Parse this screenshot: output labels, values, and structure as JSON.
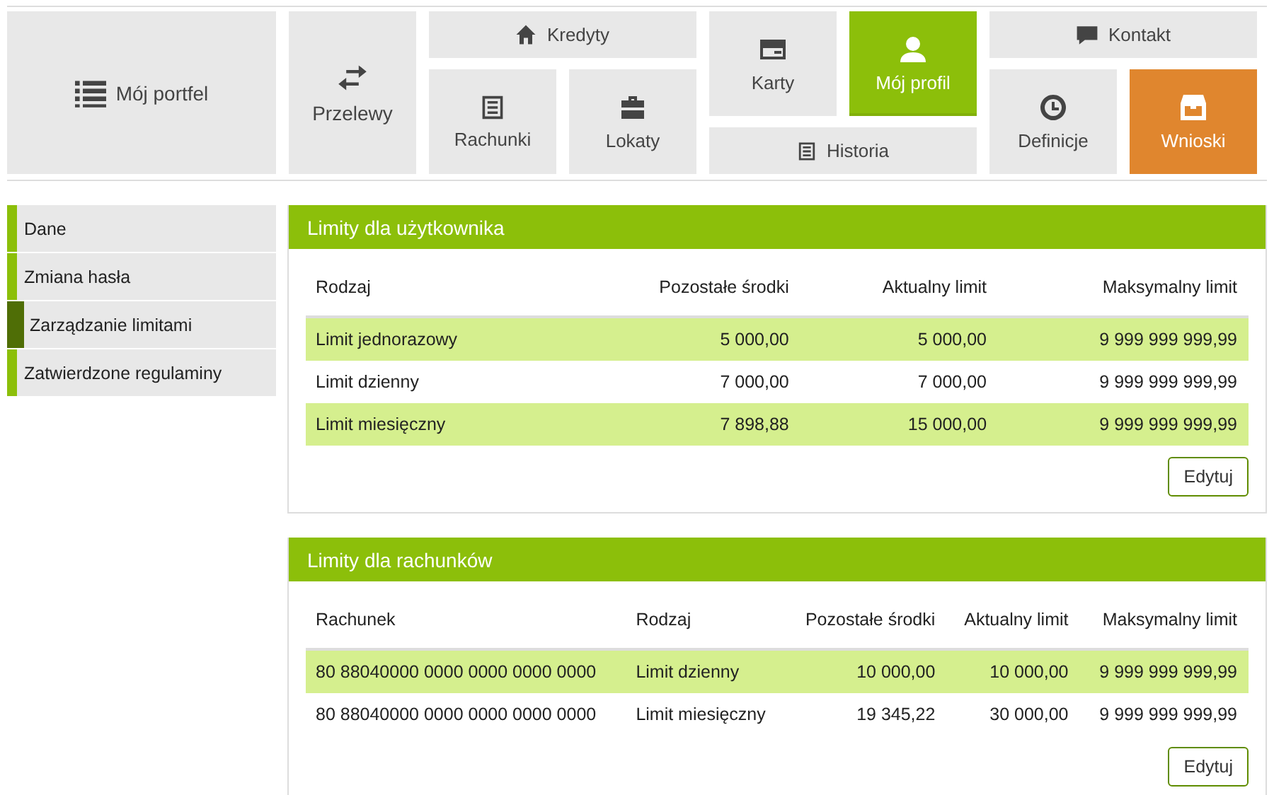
{
  "tiles": [
    {
      "label": "Mój portfel",
      "selected": false,
      "color": "#e8e8e8"
    },
    {
      "label": "Przelewy",
      "selected": false,
      "color": "#e8e8e8"
    },
    {
      "label": "Kredyty",
      "selected": false,
      "color": "#e8e8e8"
    },
    {
      "label": "Rachunki",
      "selected": false,
      "color": "#e8e8e8"
    },
    {
      "label": "Lokaty",
      "selected": false,
      "color": "#e8e8e8"
    },
    {
      "label": "Karty",
      "selected": false,
      "color": "#e8e8e8"
    },
    {
      "label": "Mój profil",
      "selected": true,
      "color": "#8cbf0a"
    },
    {
      "label": "Historia",
      "selected": false,
      "color": "#e8e8e8"
    },
    {
      "label": "Kontakt",
      "selected": false,
      "color": "#e8e8e8"
    },
    {
      "label": "Definicje",
      "selected": false,
      "color": "#e8e8e8"
    },
    {
      "label": "Wnioski",
      "selected": false,
      "color": "#e0862e"
    }
  ],
  "sidebar": {
    "items": [
      {
        "label": "Dane",
        "selected": false
      },
      {
        "label": "Zmiana hasła",
        "selected": false
      },
      {
        "label": "Zarządzanie limitami",
        "selected": true
      },
      {
        "label": "Zatwierdzone regulaminy",
        "selected": false
      }
    ]
  },
  "panels": [
    {
      "title": "Limity dla użytkownika",
      "columns": [
        "Rodzaj",
        "Pozostałe środki",
        "Aktualny limit",
        "Maksymalny limit"
      ],
      "rows": [
        [
          "Limit jednorazowy",
          "5 000,00",
          "5 000,00",
          "9 999 999 999,99"
        ],
        [
          "Limit dzienny",
          "7 000,00",
          "7 000,00",
          "9 999 999 999,99"
        ],
        [
          "Limit miesięczny",
          "7 898,88",
          "15 000,00",
          "9 999 999 999,99"
        ]
      ],
      "button": "Edytuj"
    },
    {
      "title": "Limity dla rachunków",
      "columns": [
        "Rachunek",
        "Rodzaj",
        "Pozostałe środki",
        "Aktualny limit",
        "Maksymalny limit"
      ],
      "rows": [
        [
          "80 88040000 0000 0000 0000 0000",
          "Limit dzienny",
          "10 000,00",
          "10 000,00",
          "9 999 999 999,99"
        ],
        [
          "80 88040000 0000 0000 0000 0000",
          "Limit miesięczny",
          "19 345,22",
          "30 000,00",
          "9 999 999 999,99"
        ]
      ],
      "button": "Edytuj"
    }
  ]
}
